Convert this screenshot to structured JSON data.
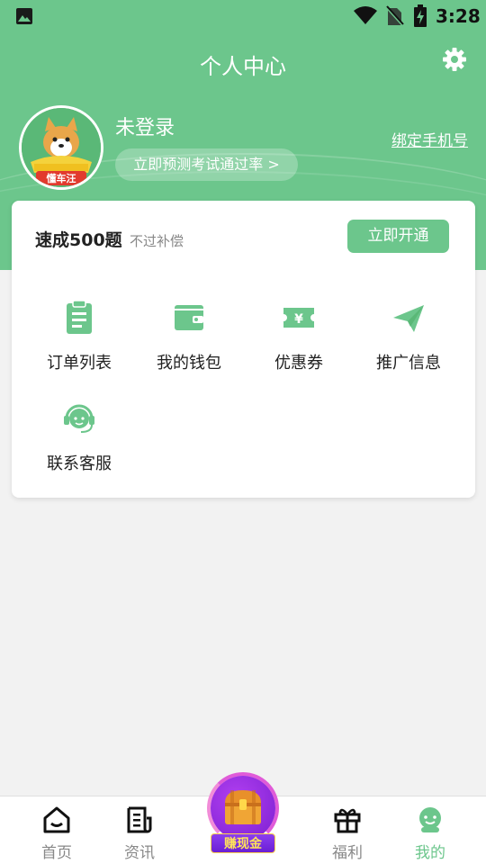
{
  "status_bar": {
    "time": "3:28",
    "icons": [
      "image-icon",
      "wifi-icon",
      "no-sim-icon",
      "battery-charging-icon"
    ]
  },
  "header": {
    "title": "个人中心",
    "settings_icon": "gear-icon",
    "background_color": "#6cc68c"
  },
  "profile": {
    "avatar_label": "懂车汪",
    "login_status": "未登录",
    "predict_button": "立即预测考试通过率 >",
    "bind_phone_link": "绑定手机号"
  },
  "promo_card": {
    "title": "速成500题",
    "subtitle": "不过补偿",
    "action_button": "立即开通",
    "items": [
      {
        "label": "订单列表",
        "icon": "clipboard-icon"
      },
      {
        "label": "我的钱包",
        "icon": "wallet-icon"
      },
      {
        "label": "优惠券",
        "icon": "coupon-icon"
      },
      {
        "label": "推广信息",
        "icon": "paper-plane-icon"
      },
      {
        "label": "联系客服",
        "icon": "customer-service-icon"
      }
    ]
  },
  "tab_bar": {
    "tabs": [
      {
        "label": "首页",
        "icon": "home-icon",
        "active": false
      },
      {
        "label": "资讯",
        "icon": "news-icon",
        "active": false
      },
      {
        "label": "赚现金",
        "icon": "treasure-chest-icon",
        "active": false
      },
      {
        "label": "福利",
        "icon": "gift-icon",
        "active": false
      },
      {
        "label": "我的",
        "icon": "profile-icon",
        "active": true
      }
    ],
    "active_color": "#6cc68c"
  }
}
